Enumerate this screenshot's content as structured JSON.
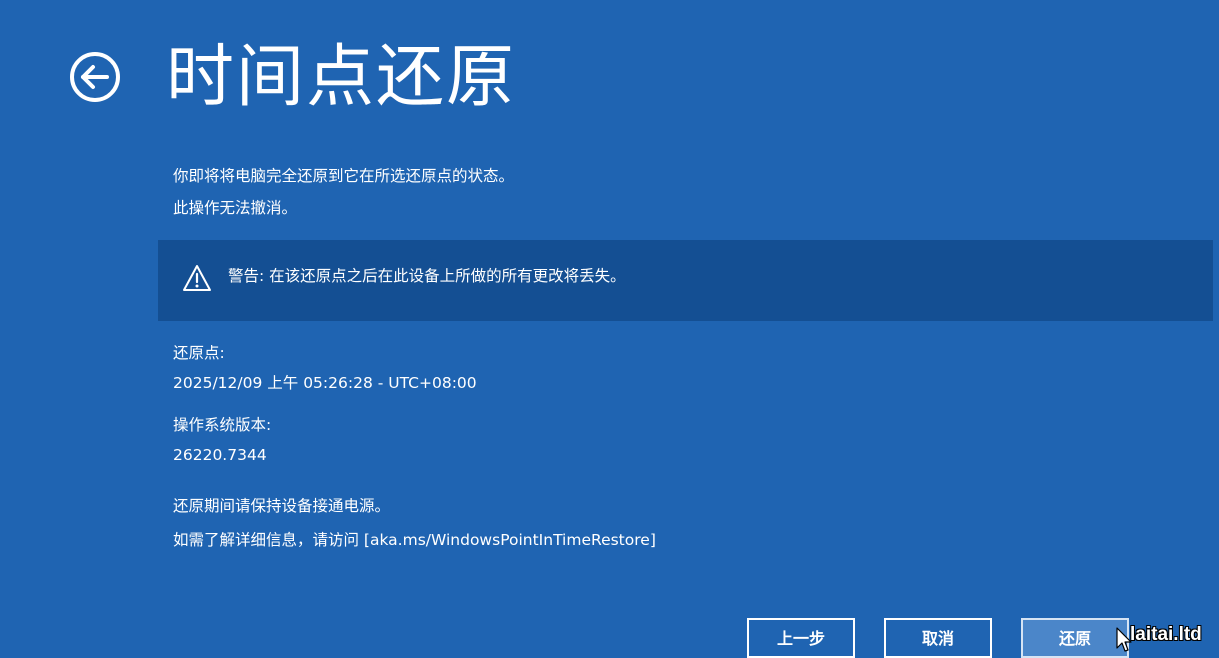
{
  "header": {
    "title": "时间点还原"
  },
  "description": {
    "line1": "你即将将电脑完全还原到它在所选还原点的状态。",
    "line2": "此操作无法撤消。"
  },
  "warning": {
    "icon": "warning-triangle-icon",
    "text": "警告: 在该还原点之后在此设备上所做的所有更改将丢失。"
  },
  "details": {
    "restore_point_label": "还原点:",
    "restore_point_value": "2025/12/09 上午 05:26:28 - UTC+08:00",
    "os_version_label": "操作系统版本:",
    "os_version_value": "26220.7344"
  },
  "footer": {
    "power_notice": "还原期间请保持设备接通电源。",
    "more_info": "如需了解详细信息，请访问 [aka.ms/WindowsPointInTimeRestore]"
  },
  "buttons": {
    "back_label": "上一步",
    "cancel_label": "取消",
    "restore_label": "还原"
  },
  "watermark": "laitai.ltd",
  "colors": {
    "background": "#1f64b2",
    "warning_background": "#144f93",
    "primary_button": "#4b86c9",
    "text": "#ffffff"
  }
}
